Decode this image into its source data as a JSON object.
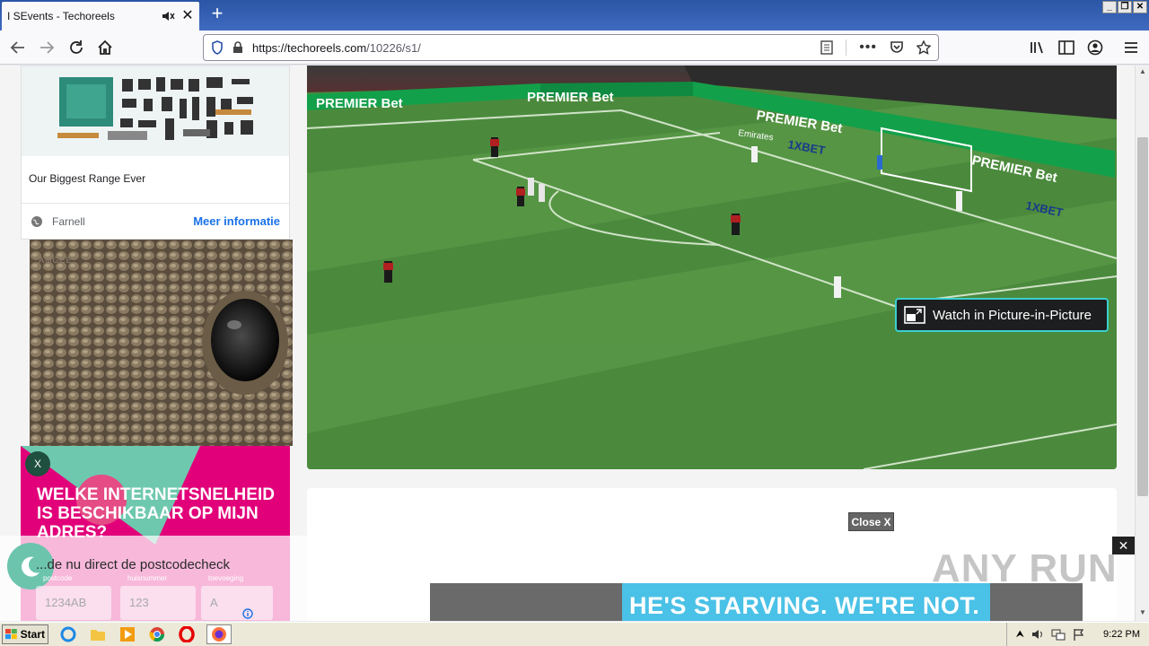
{
  "browser": {
    "tab_title": "I SEvents - Techoreels",
    "url_domain": "https://techoreels.com",
    "url_path": "/10226/s1/",
    "new_tab": "+"
  },
  "page": {
    "ad_caption": "Our Biggest Range Ever",
    "ad_brand": "Farnell",
    "ad_cta": "Meer informatie",
    "eye_brand": "AMGEE",
    "pink_ad": {
      "close": "X",
      "headline": "WELKE INTERNETSNELHEID IS BESCHIKBAAR OP MIJN ADRES?",
      "subline": "...de nu direct de postcodecheck",
      "labels": [
        "postcode",
        "huisnummer",
        "toevoeging"
      ],
      "placeholders": [
        "1234AB",
        "123",
        "A"
      ]
    },
    "pip_label": "Watch in Picture-in-Picture",
    "close_x": "Close X",
    "overlay_close": "✕",
    "banner_text": "HE'S STARVING.  WE'RE NOT.",
    "watermark": "ANY RUN",
    "video_boards": [
      "PREMIER Bet",
      "PREMIER Bet",
      "PREMIER Bet",
      "PREMIER Bet",
      "1XBET",
      "1XBET",
      "Emirates",
      "1XBET"
    ]
  },
  "taskbar": {
    "start": "Start",
    "clock": "9:22 PM"
  },
  "colors": {
    "accent": "#1a73e8",
    "pink": "#e2007a",
    "pip_border": "#3ad0d0"
  }
}
